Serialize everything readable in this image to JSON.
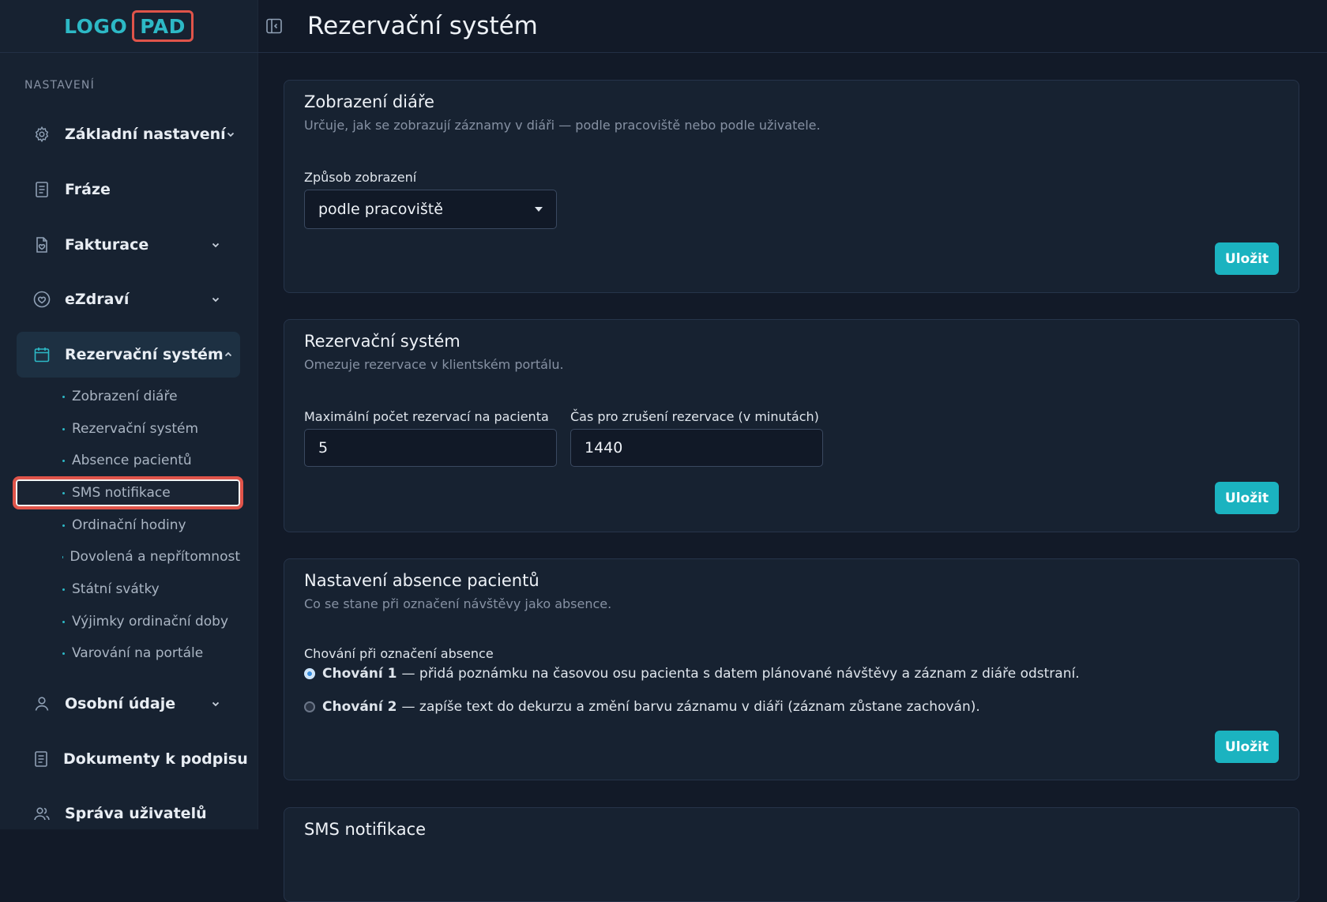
{
  "logo": {
    "part1": "LOGO",
    "part2": "PAD"
  },
  "sidebar": {
    "section_label": "NASTAVENÍ",
    "items": [
      {
        "label": "Základní nastavení",
        "icon": "gear-icon"
      },
      {
        "label": "Fráze",
        "icon": "document-icon"
      },
      {
        "label": "Fakturace",
        "icon": "invoice-icon"
      },
      {
        "label": "eZdraví",
        "icon": "heart-icon"
      },
      {
        "label": "Rezervační systém",
        "icon": "calendar-icon"
      },
      {
        "label": "Osobní údaje",
        "icon": "user-icon"
      },
      {
        "label": "Dokumenty k podpisu",
        "icon": "document-icon"
      },
      {
        "label": "Správa uživatelů",
        "icon": "users-icon"
      }
    ],
    "subitems": [
      "Zobrazení diáře",
      "Rezervační systém",
      "Absence pacientů",
      "SMS notifikace",
      "Ordinační hodiny",
      "Dovolená a nepřítomnost",
      "Státní svátky",
      "Výjimky ordinační doby",
      "Varování na portále"
    ]
  },
  "header": {
    "title": "Rezervační systém"
  },
  "cards": {
    "diary": {
      "title": "Zobrazení diáře",
      "subtitle": "Určuje, jak se zobrazují záznamy v diáři — podle pracoviště nebo podle uživatele.",
      "field_label": "Způsob zobrazení",
      "select_value": "podle pracoviště",
      "save": "Uložit"
    },
    "reservation": {
      "title": "Rezervační systém",
      "subtitle": "Omezuje rezervace v klientském portálu.",
      "max_label": "Maximální počet rezervací na pacienta",
      "max_value": "5",
      "cancel_label": "Čas pro zrušení rezervace (v minutách)",
      "cancel_value": "1440",
      "save": "Uložit"
    },
    "absence": {
      "title": "Nastavení absence pacientů",
      "subtitle": "Co se stane při označení návštěvy jako absence.",
      "field_label": "Chování při označení absence",
      "option1_strong": "Chování 1",
      "option1_text": "— přidá poznámku na časovou osu pacienta s datem plánované návštěvy a záznam z diáře odstraní.",
      "option2_strong": "Chování 2",
      "option2_text": "— zapíše text do dekurzu a změní barvu záznamu v diáři (záznam zůstane zachován).",
      "save": "Uložit"
    },
    "sms": {
      "title": "SMS notifikace"
    }
  },
  "colors": {
    "accent": "#1bb3c0",
    "highlight": "#e0544a",
    "background": "#121a28",
    "panel": "#172231"
  }
}
